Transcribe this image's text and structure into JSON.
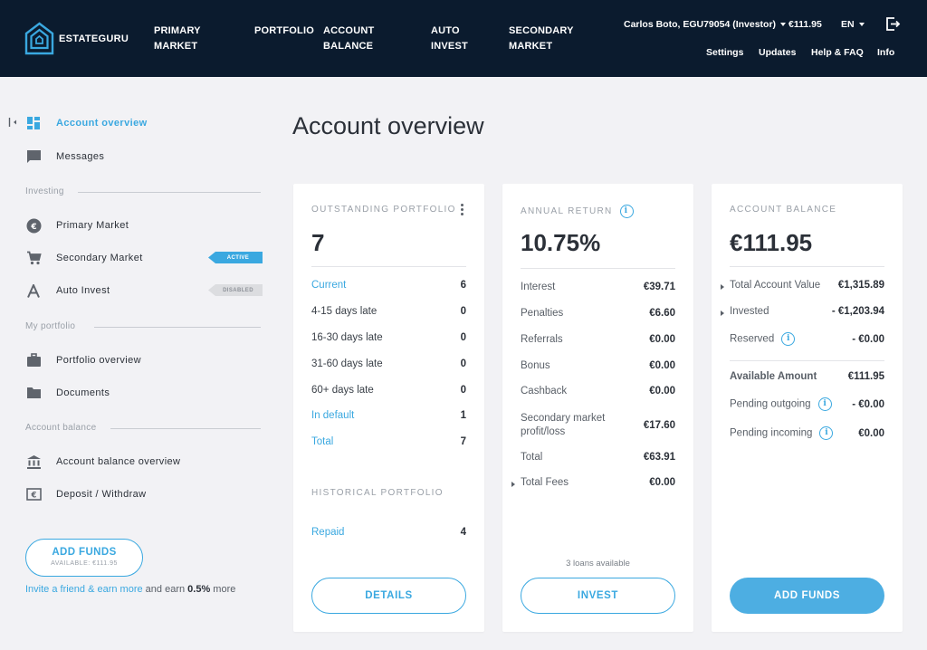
{
  "header": {
    "logo_text": "ESTATEGURU",
    "nav": [
      {
        "line1": "PRIMARY",
        "line2": "MARKET"
      },
      {
        "line1": "PORTFOLIO",
        "line2": ""
      },
      {
        "line1": "ACCOUNT",
        "line2": "BALANCE"
      },
      {
        "line1": "AUTO",
        "line2": "INVEST"
      },
      {
        "line1": "SECONDARY",
        "line2": "MARKET"
      }
    ],
    "user": "Carlos Boto, EGU79054 (Investor)",
    "balance": "€111.95",
    "language": "EN",
    "links": [
      "Settings",
      "Updates",
      "Help & FAQ",
      "Info"
    ]
  },
  "sidebar": {
    "items": [
      {
        "label": "Account overview",
        "icon": "dashboard-icon"
      },
      {
        "label": "Messages",
        "icon": "message-icon"
      },
      {
        "label": "Primary Market",
        "icon": "euro-coin-icon"
      },
      {
        "label": "Secondary Market",
        "icon": "cart-icon",
        "badge": "ACTIVE"
      },
      {
        "label": "Auto Invest",
        "icon": "auto-invest-icon",
        "badge": "DISABLED"
      },
      {
        "label": "Portfolio overview",
        "icon": "briefcase-icon"
      },
      {
        "label": "Documents",
        "icon": "folder-icon"
      },
      {
        "label": "Account balance overview",
        "icon": "bank-icon"
      },
      {
        "label": "Deposit / Withdraw",
        "icon": "euro-note-icon"
      }
    ],
    "sections": [
      "Investing",
      "My portfolio",
      "Account balance"
    ],
    "add_funds": {
      "label": "ADD FUNDS",
      "available": "AVAILABLE: €111.95"
    },
    "invite": {
      "link": "Invite a friend & earn more",
      "text1": " and earn ",
      "bold": "0.5%",
      "text2": " more"
    }
  },
  "page_title": "Account overview",
  "portfolio_card": {
    "title": "OUTSTANDING PORTFOLIO",
    "count": "7",
    "rows": [
      {
        "label": "Current",
        "value": "6"
      },
      {
        "label": "4-15 days late",
        "value": "0"
      },
      {
        "label": "16-30 days late",
        "value": "0"
      },
      {
        "label": "31-60 days late",
        "value": "0"
      },
      {
        "label": "60+ days late",
        "value": "0"
      },
      {
        "label": "In default",
        "value": "1"
      },
      {
        "label": "Total",
        "value": "7"
      }
    ],
    "historical_title": "HISTORICAL PORTFOLIO",
    "historical_rows": [
      {
        "label": "Repaid",
        "value": "4"
      }
    ],
    "button": "DETAILS"
  },
  "return_card": {
    "title": "ANNUAL RETURN",
    "value": "10.75%",
    "rows": [
      {
        "label": "Interest",
        "value": "€39.71"
      },
      {
        "label": "Penalties",
        "value": "€6.60"
      },
      {
        "label": "Referrals",
        "value": "€0.00"
      },
      {
        "label": "Bonus",
        "value": "€0.00"
      },
      {
        "label": "Cashback",
        "value": "€0.00"
      },
      {
        "label": "Secondary market profit/loss",
        "value": "€17.60"
      },
      {
        "label": "Total",
        "value": "€63.91"
      },
      {
        "label": "Total Fees",
        "value": "€0.00"
      }
    ],
    "loans_available": "3 loans available",
    "button": "INVEST"
  },
  "balance_card": {
    "title": "ACCOUNT BALANCE",
    "value": "€111.95",
    "rows": [
      {
        "label": "Total Account Value",
        "value": "€1,315.89"
      },
      {
        "label": "Invested",
        "value": "- €1,203.94"
      },
      {
        "label": "Reserved",
        "value": "- €0.00"
      },
      {
        "label": "Available Amount",
        "value": "€111.95"
      },
      {
        "label": "Pending outgoing",
        "value": "- €0.00"
      },
      {
        "label": "Pending incoming",
        "value": "€0.00"
      }
    ],
    "button": "ADD FUNDS"
  },
  "colors": {
    "accent": "#3aa8e0",
    "header_bg": "#0b1b2e",
    "page_bg": "#f2f2f5"
  }
}
